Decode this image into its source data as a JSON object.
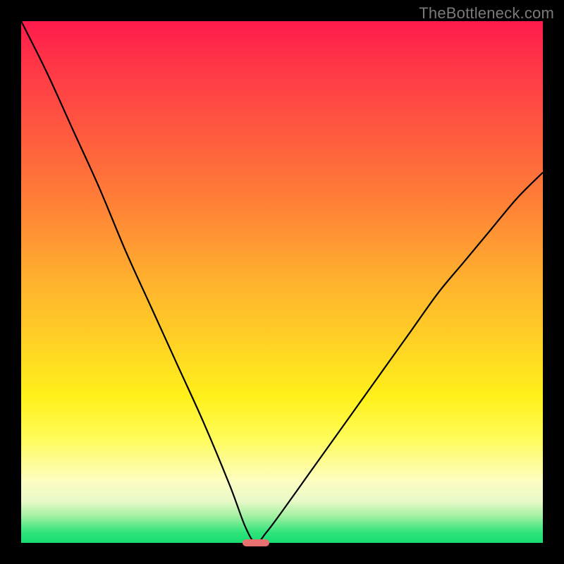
{
  "watermark": "TheBottleneck.com",
  "chart_data": {
    "type": "line",
    "title": "",
    "xlabel": "",
    "ylabel": "",
    "xlim": [
      0,
      100
    ],
    "ylim": [
      0,
      100
    ],
    "grid": false,
    "legend": null,
    "series": [
      {
        "name": "bottleneck-curve",
        "x": [
          0,
          5,
          10,
          15,
          20,
          25,
          30,
          35,
          40,
          43,
          45,
          47,
          50,
          55,
          60,
          65,
          70,
          75,
          80,
          85,
          90,
          95,
          100
        ],
        "values": [
          100,
          90,
          79,
          68,
          56,
          45,
          34,
          23,
          11,
          3,
          0,
          2,
          6,
          13,
          20,
          27,
          34,
          41,
          48,
          54,
          60,
          66,
          71
        ]
      }
    ],
    "marker": {
      "x": 45,
      "y": 0,
      "width_pct": 5.2,
      "height_pct": 1.4
    },
    "gradient_stops": [
      {
        "pos": 0,
        "color": "#ff1a4d"
      },
      {
        "pos": 36,
        "color": "#ff8436"
      },
      {
        "pos": 72,
        "color": "#fff01a"
      },
      {
        "pos": 95,
        "color": "#9ef0a0"
      },
      {
        "pos": 100,
        "color": "#16dd74"
      }
    ]
  }
}
